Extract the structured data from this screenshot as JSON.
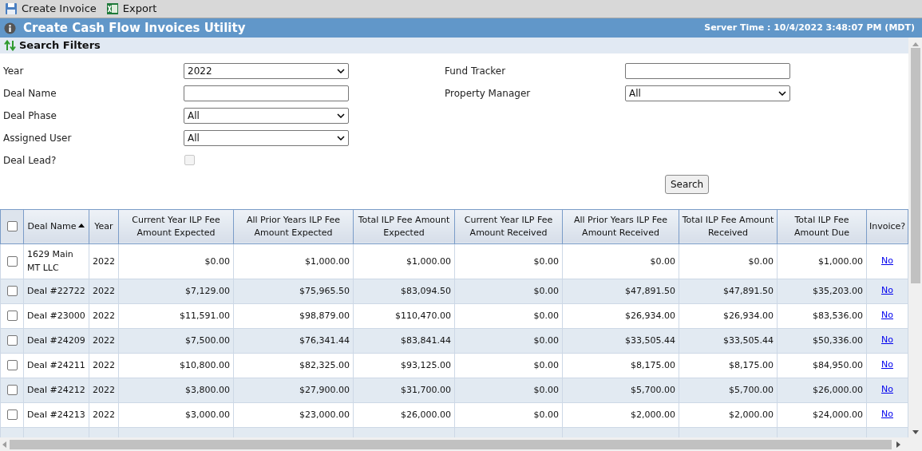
{
  "toolbar": [
    {
      "kind": "save",
      "label": "Create Invoice"
    },
    {
      "kind": "excel",
      "label": "Export"
    }
  ],
  "title": "Create Cash Flow Invoices Utility",
  "server_time": "Server Time : 10/4/2022 3:48:07 PM (MDT)",
  "filters_title": "Search Filters",
  "filters_left": [
    {
      "label": "Year",
      "kind": "select",
      "value": "2022"
    },
    {
      "label": "Deal Name",
      "kind": "text"
    },
    {
      "label": "Deal Phase",
      "kind": "select",
      "value": "All"
    },
    {
      "label": "Assigned User",
      "kind": "select",
      "value": "All"
    },
    {
      "label": "Deal Lead?",
      "kind": "checkbox",
      "checked": false,
      "disabled": true
    }
  ],
  "filters_right": [
    {
      "label": "Fund Tracker",
      "kind": "text"
    },
    {
      "label": "Property Manager",
      "kind": "select",
      "value": "All"
    }
  ],
  "search_button": "Search",
  "table": {
    "select_all_checked": false,
    "columns": [
      {
        "label": "Deal Name",
        "sorted": true
      },
      {
        "label": "Year",
        "sorted": false
      },
      {
        "label": "Current Year ILP Fee Amount Expected",
        "sorted": false
      },
      {
        "label": "All Prior Years ILP Fee Amount Expected",
        "sorted": false
      },
      {
        "label": "Total ILP Fee Amount Expected",
        "sorted": false
      },
      {
        "label": "Current Year ILP Fee Amount Received",
        "sorted": false
      },
      {
        "label": "All Prior Years ILP Fee Amount Received",
        "sorted": false
      },
      {
        "label": "Total ILP Fee Amount Received",
        "sorted": false
      },
      {
        "label": "Total ILP Fee Amount Due",
        "sorted": false
      },
      {
        "label": "Invoice?",
        "sorted": false
      }
    ],
    "rows": [
      {
        "checked": false,
        "cells": [
          "1629 Main MT LLC",
          "2022",
          "$0.00",
          "$1,000.00",
          "$1,000.00",
          "$0.00",
          "$0.00",
          "$0.00",
          "$1,000.00",
          "No"
        ]
      },
      {
        "checked": false,
        "cells": [
          "Deal #22722",
          "2022",
          "$7,129.00",
          "$75,965.50",
          "$83,094.50",
          "$0.00",
          "$47,891.50",
          "$47,891.50",
          "$35,203.00",
          "No"
        ]
      },
      {
        "checked": false,
        "cells": [
          "Deal #23000",
          "2022",
          "$11,591.00",
          "$98,879.00",
          "$110,470.00",
          "$0.00",
          "$26,934.00",
          "$26,934.00",
          "$83,536.00",
          "No"
        ]
      },
      {
        "checked": false,
        "cells": [
          "Deal #24209",
          "2022",
          "$7,500.00",
          "$76,341.44",
          "$83,841.44",
          "$0.00",
          "$33,505.44",
          "$33,505.44",
          "$50,336.00",
          "No"
        ]
      },
      {
        "checked": false,
        "cells": [
          "Deal #24211",
          "2022",
          "$10,800.00",
          "$82,325.00",
          "$93,125.00",
          "$0.00",
          "$8,175.00",
          "$8,175.00",
          "$84,950.00",
          "No"
        ]
      },
      {
        "checked": false,
        "cells": [
          "Deal #24212",
          "2022",
          "$3,800.00",
          "$27,900.00",
          "$31,700.00",
          "$0.00",
          "$5,700.00",
          "$5,700.00",
          "$26,000.00",
          "No"
        ]
      },
      {
        "checked": false,
        "cells": [
          "Deal #24213",
          "2022",
          "$3,000.00",
          "$23,000.00",
          "$26,000.00",
          "$0.00",
          "$2,000.00",
          "$2,000.00",
          "$24,000.00",
          "No"
        ]
      }
    ]
  }
}
